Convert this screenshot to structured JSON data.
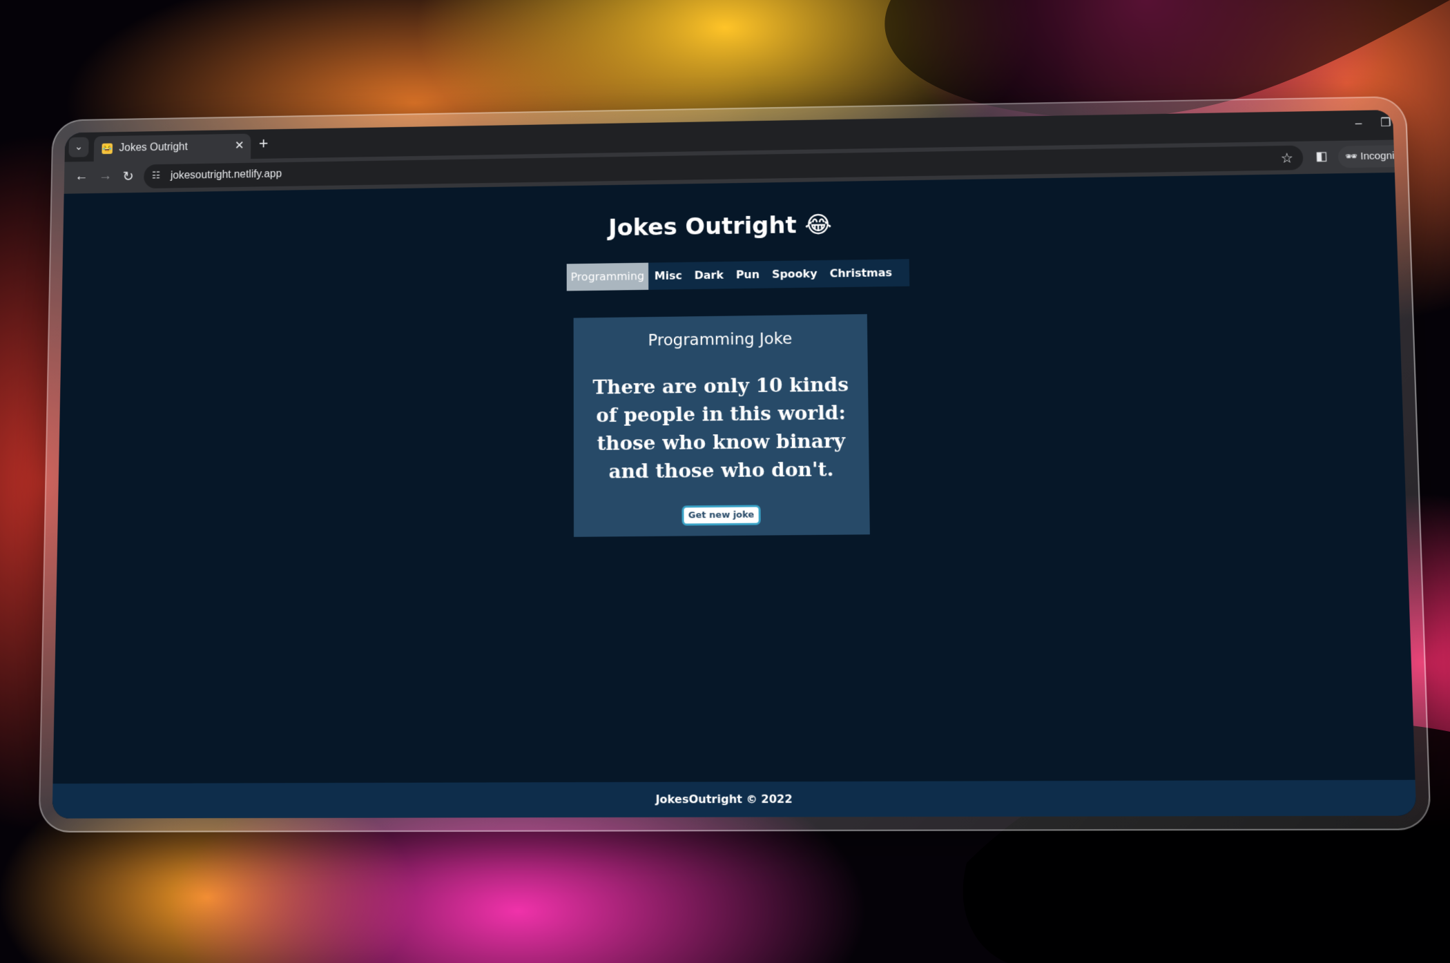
{
  "browser": {
    "tab_title": "Jokes Outright",
    "tab_close": "✕",
    "new_tab": "+",
    "url": "jokesoutright.netlify.app",
    "incognito_label": "Incognito",
    "icons": {
      "tab_search": "chevron-down-icon",
      "favicon": "laughing-emoji-icon",
      "back": "back-arrow-icon",
      "forward": "forward-arrow-icon",
      "reload": "reload-icon",
      "site_info": "site-info-icon",
      "bookmark": "star-icon",
      "side_panel": "side-panel-icon",
      "incognito": "incognito-icon",
      "menu": "more-vert-icon"
    }
  },
  "page": {
    "title": "Jokes Outright 😂",
    "categories": [
      "Programming",
      "Misc",
      "Dark",
      "Pun",
      "Spooky",
      "Christmas"
    ],
    "active_category": "Programming",
    "card": {
      "heading": "Programming Joke",
      "joke": "There are only 10 kinds of people in this world: those who know binary and those who don't.",
      "button_label": "Get new joke"
    },
    "footer": "JokesOutright © 2022"
  },
  "colors": {
    "page_bg": "#061728",
    "card_bg": "#274a68",
    "active_tab_bg": "#aab6bf",
    "footer_bg": "#0e2d4b",
    "button_border": "#3aa3c7"
  }
}
